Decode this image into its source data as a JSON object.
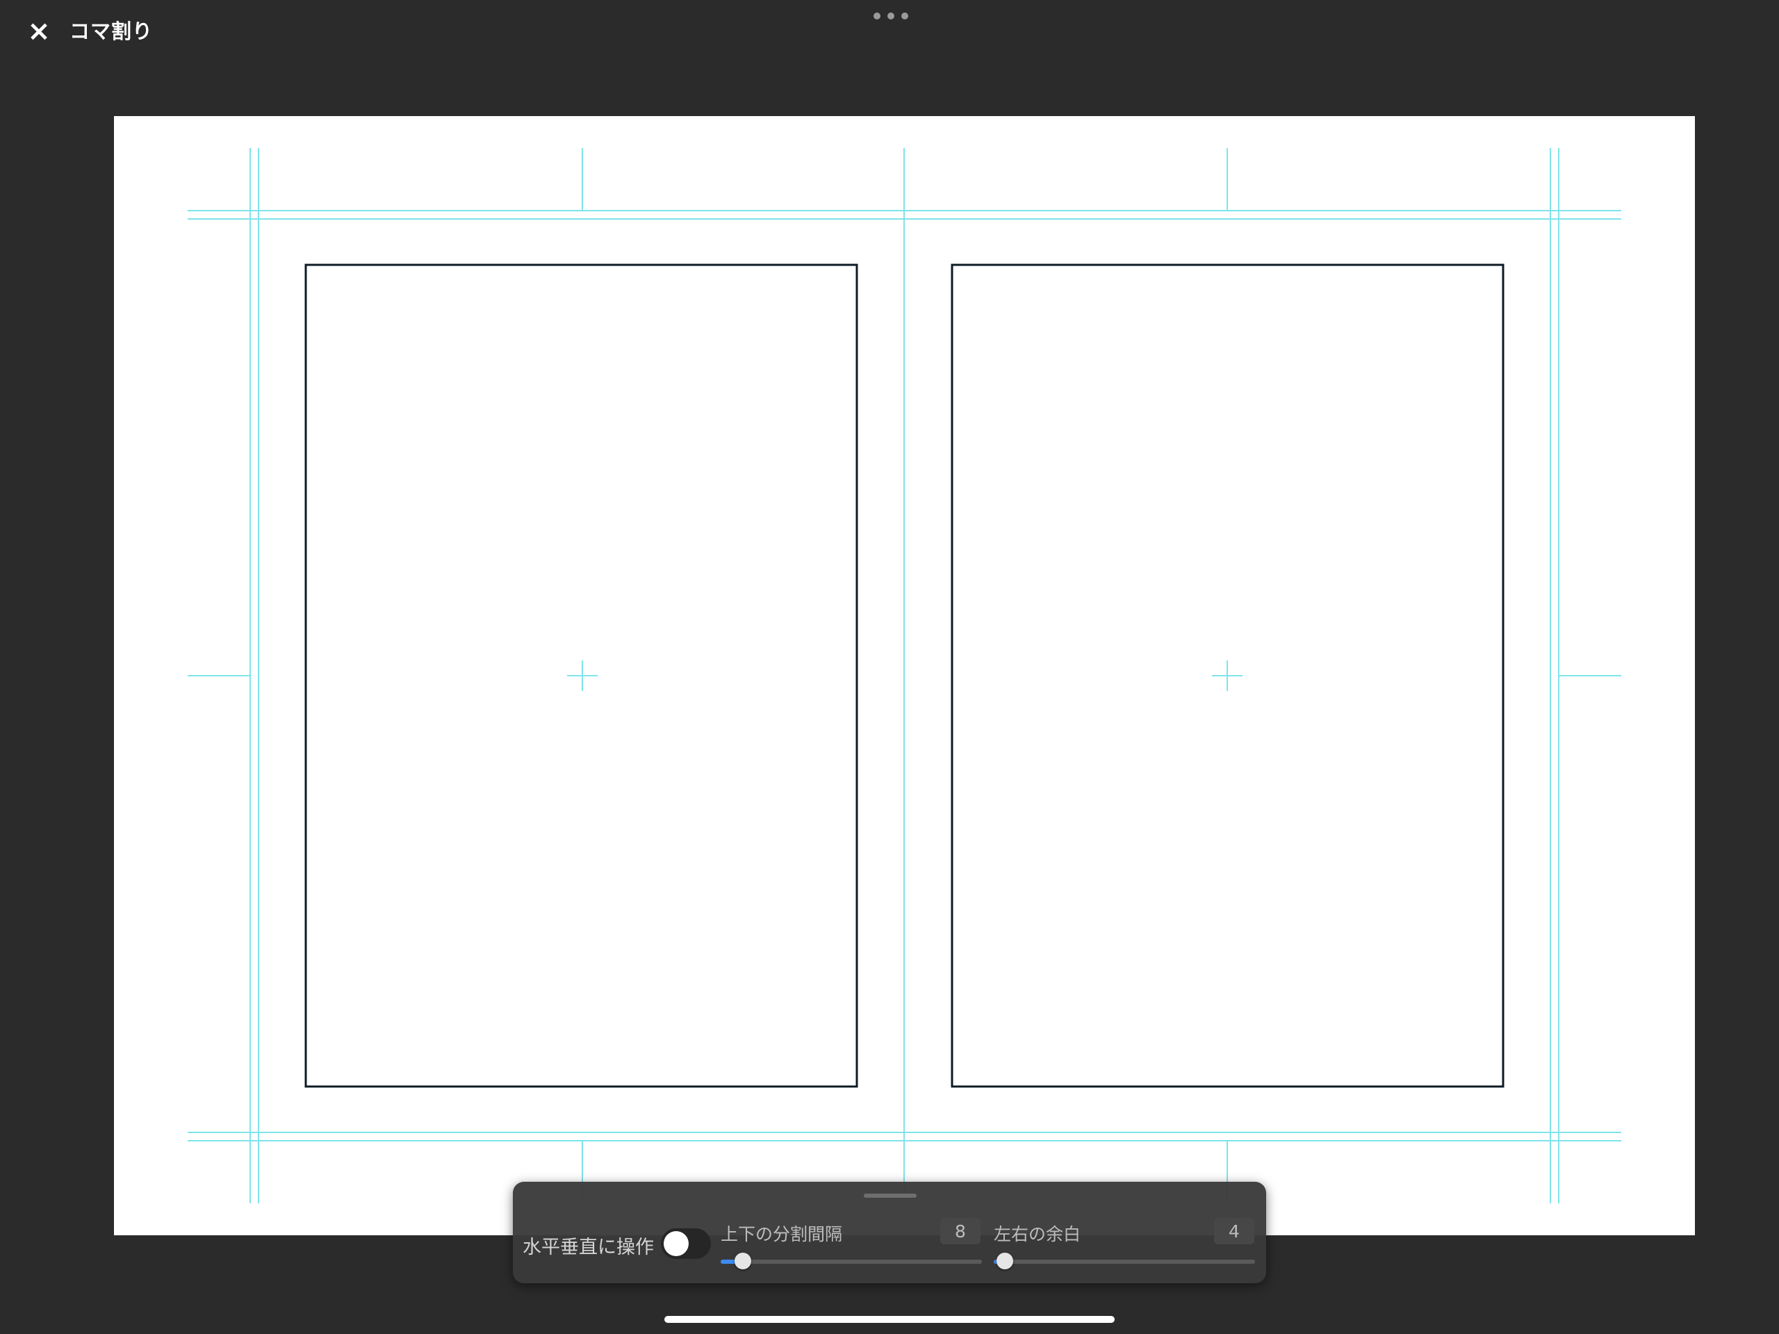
{
  "header": {
    "close_icon": "×",
    "title": "コマ割り",
    "more_icon": "ellipsis-icon"
  },
  "canvas": {
    "panel_count": 2,
    "guide_color": "#7fe3ea",
    "frame_color": "#0d1b24"
  },
  "panel": {
    "toggle": {
      "label": "水平垂直に操作",
      "on": false
    },
    "sliders": [
      {
        "label": "上下の分割間隔",
        "value": "8",
        "fraction": 0.08
      },
      {
        "label": "左右の余白",
        "value": "4",
        "fraction": 0.04
      }
    ]
  },
  "colors": {
    "accent": "#3d8bf0",
    "background": "#2b2b2b"
  }
}
